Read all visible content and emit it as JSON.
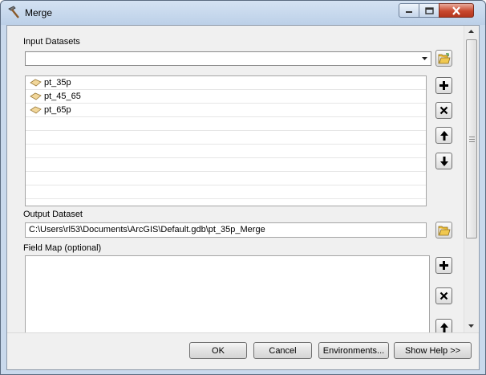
{
  "window": {
    "title": "Merge",
    "title_icon": "hammer-icon"
  },
  "input_datasets": {
    "label": "Input Datasets",
    "combo_value": "",
    "items": [
      {
        "name": "pt_35p",
        "icon": "feature-class-icon"
      },
      {
        "name": "pt_45_65",
        "icon": "feature-class-icon"
      },
      {
        "name": "pt_65p",
        "icon": "feature-class-icon"
      }
    ]
  },
  "output_dataset": {
    "label": "Output Dataset",
    "value": "C:\\Users\\rl53\\Documents\\ArcGIS\\Default.gdb\\pt_35p_Merge"
  },
  "field_map": {
    "label": "Field Map (optional)"
  },
  "buttons": {
    "ok": "OK",
    "cancel": "Cancel",
    "environments": "Environments...",
    "show_help": "Show Help >>"
  },
  "colors": {
    "titlebar": "#c9d9ec",
    "close_button": "#c8482e",
    "client_bg": "#f0f0f0"
  }
}
